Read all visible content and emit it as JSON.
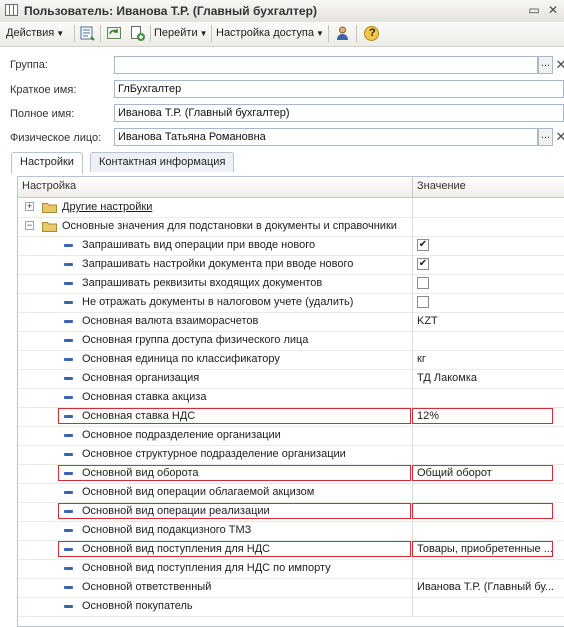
{
  "window": {
    "title": "Пользователь: Иванова Т.Р. (Главный бухгалтер)"
  },
  "toolbar": {
    "actions_label": "Действия",
    "goto_label": "Перейти",
    "access_label": "Настройка доступа",
    "help_label": "?"
  },
  "form": {
    "group_label": "Группа:",
    "group_value": "",
    "short_name_label": "Краткое имя:",
    "short_name_value": "ГлБухгалтер",
    "full_name_label": "Полное имя:",
    "full_name_value": "Иванова Т.Р. (Главный бухгалтер)",
    "person_label": "Физическое лицо:",
    "person_value": "Иванова Татьяна Романовна",
    "select_glyph": "...",
    "clear_glyph": "✕"
  },
  "tabs": [
    "Настройки",
    "Контактная информация"
  ],
  "table": {
    "columns": [
      "Настройка",
      "Значение"
    ],
    "groups": [
      {
        "label": "Другие настройки",
        "expander": "+"
      },
      {
        "label": "Основные значения для подстановки в документы и справочники",
        "expander": "−"
      }
    ],
    "rows": [
      {
        "name": "Запрашивать вид операции при вводе нового",
        "value": "",
        "checkbox": true,
        "checked": true,
        "highlight": false
      },
      {
        "name": "Запрашивать настройки документа при вводе нового",
        "value": "",
        "checkbox": true,
        "checked": true,
        "highlight": false
      },
      {
        "name": "Запрашивать реквизиты входящих документов",
        "value": "",
        "checkbox": true,
        "checked": false,
        "highlight": false
      },
      {
        "name": "Не отражать документы в налоговом учете (удалить)",
        "value": "",
        "checkbox": true,
        "checked": false,
        "highlight": false
      },
      {
        "name": "Основная валюта взаиморасчетов",
        "value": "KZT",
        "checkbox": false,
        "checked": false,
        "highlight": false
      },
      {
        "name": "Основная группа доступа физического лица",
        "value": "",
        "checkbox": false,
        "checked": false,
        "highlight": false
      },
      {
        "name": "Основная единица по классификатору",
        "value": "кг",
        "checkbox": false,
        "checked": false,
        "highlight": false
      },
      {
        "name": "Основная организация",
        "value": "ТД Лакомка",
        "checkbox": false,
        "checked": false,
        "highlight": false
      },
      {
        "name": "Основная ставка акциза",
        "value": "",
        "checkbox": false,
        "checked": false,
        "highlight": false
      },
      {
        "name": "Основная ставка НДС",
        "value": "12%",
        "checkbox": false,
        "checked": false,
        "highlight": true
      },
      {
        "name": "Основное подразделение организации",
        "value": "",
        "checkbox": false,
        "checked": false,
        "highlight": false
      },
      {
        "name": "Основное структурное подразделение организации",
        "value": "",
        "checkbox": false,
        "checked": false,
        "highlight": false
      },
      {
        "name": "Основной вид оборота",
        "value": "Общий оборот",
        "checkbox": false,
        "checked": false,
        "highlight": true
      },
      {
        "name": "Основной вид операции облагаемой акцизом",
        "value": "",
        "checkbox": false,
        "checked": false,
        "highlight": false
      },
      {
        "name": "Основной вид операции реализации",
        "value": "",
        "checkbox": false,
        "checked": false,
        "highlight": true
      },
      {
        "name": "Основной вид подакцизного ТМЗ",
        "value": "",
        "checkbox": false,
        "checked": false,
        "highlight": false
      },
      {
        "name": "Основной вид поступления для НДС",
        "value": "Товары, приобретенные ...",
        "checkbox": false,
        "checked": false,
        "highlight": true
      },
      {
        "name": "Основной вид поступления для НДС по импорту",
        "value": "",
        "checkbox": false,
        "checked": false,
        "highlight": false
      },
      {
        "name": "Основной ответственный",
        "value": "Иванова Т.Р. (Главный бу...",
        "checkbox": false,
        "checked": false,
        "highlight": false
      },
      {
        "name": "Основной покупатель",
        "value": "",
        "checkbox": false,
        "checked": false,
        "highlight": false
      }
    ]
  },
  "colors": {
    "highlight": "#d42b38",
    "accent": "#3a64ad"
  }
}
